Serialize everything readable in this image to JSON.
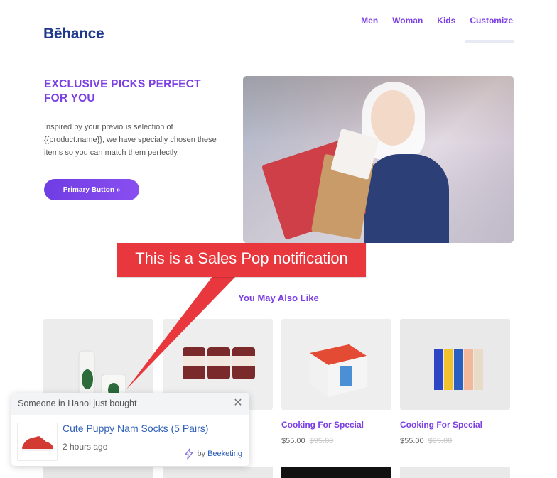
{
  "header": {
    "logo": "Bēhance",
    "nav": [
      "Men",
      "Woman",
      "Kids",
      "Customize"
    ]
  },
  "hero": {
    "title": "EXCLUSIVE PICKS PERFECT FOR YOU",
    "description": "Inspired by your previous selection of {{product.name}}, we have specially chosen these items so you can match them perfectly.",
    "button_label": "Primary Button »"
  },
  "callout": {
    "text": "This is a Sales Pop notification",
    "color": "#e8383d"
  },
  "section": {
    "title": "You May Also Like"
  },
  "products": [
    {
      "name": "",
      "price": "",
      "old_price": ""
    },
    {
      "name": "",
      "price": "",
      "old_price": ""
    },
    {
      "name": "Cooking For Special",
      "price": "$55.00",
      "old_price": "$95.00"
    },
    {
      "name": "Cooking For Special",
      "price": "$55.00",
      "old_price": "$95.00"
    }
  ],
  "notification": {
    "header": "Someone in Hanoi just bought",
    "product": "Cute Puppy Nam Socks (5 Pairs)",
    "time": "2 hours ago",
    "by_label": "by",
    "brand": "Beeketing",
    "icons": {
      "close": "close-icon",
      "bolt": "lightning-icon"
    }
  },
  "colors": {
    "accent": "#7b3fe4",
    "logo": "#1f3a8c",
    "link": "#2f5fb8"
  }
}
